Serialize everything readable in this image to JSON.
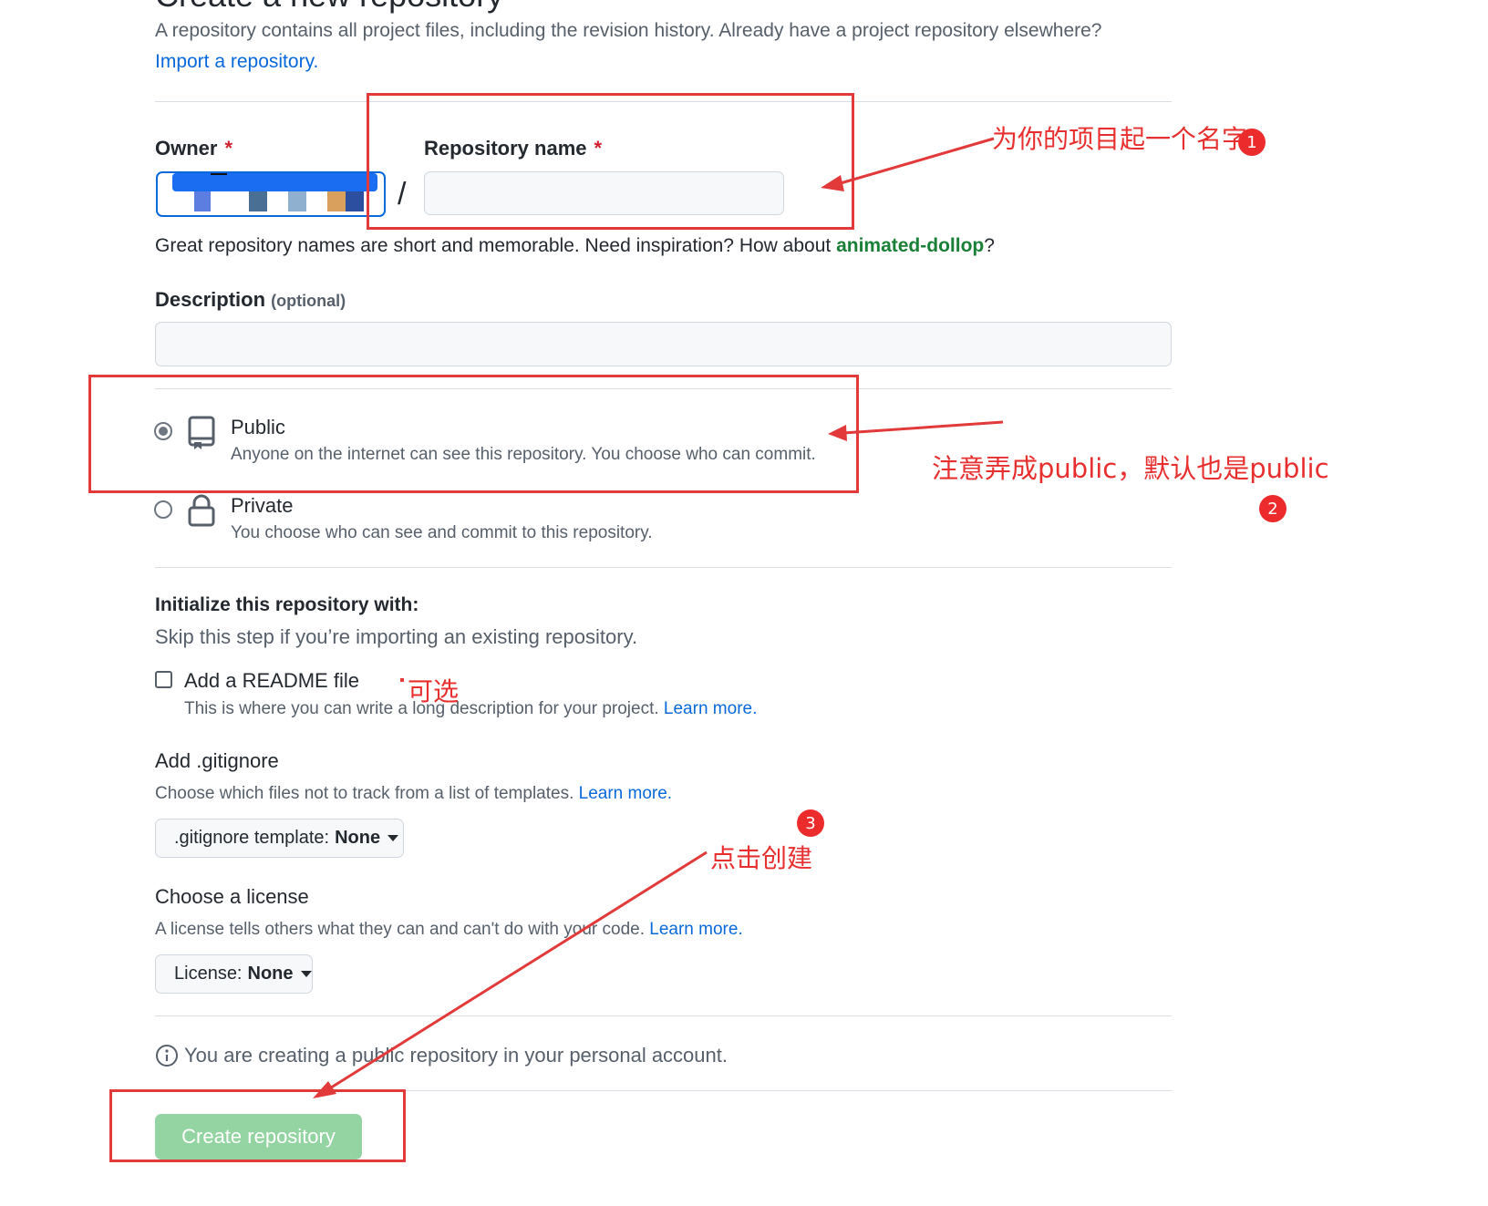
{
  "header": {
    "title_fragment": "Create a new repository",
    "intro_text": "A repository contains all project files, including the revision history. Already have a project repository elsewhere?",
    "import_link": "Import a repository."
  },
  "owner": {
    "label": "Owner",
    "required_mark": "*",
    "separator": "/"
  },
  "repo_name": {
    "label": "Repository name",
    "required_mark": "*",
    "value": ""
  },
  "name_hint": {
    "prefix": "Great repository names are short and memorable. Need inspiration? How about ",
    "suggestion": "animated-dollop",
    "suffix": "?"
  },
  "description": {
    "label": "Description",
    "optional": "(optional)",
    "value": ""
  },
  "visibility": {
    "public": {
      "title": "Public",
      "desc": "Anyone on the internet can see this repository. You choose who can commit.",
      "selected": true
    },
    "private": {
      "title": "Private",
      "desc": "You choose who can see and commit to this repository.",
      "selected": false
    }
  },
  "init": {
    "heading": "Initialize this repository with:",
    "subtext": "Skip this step if you’re importing an existing repository.",
    "readme_label": "Add a README file",
    "readme_desc": "This is where you can write a long description for your project.",
    "learn_more": "Learn more."
  },
  "gitignore": {
    "heading": "Add .gitignore",
    "desc": "Choose which files not to track from a list of templates.",
    "learn_more": "Learn more.",
    "button_prefix": ".gitignore template:",
    "button_value": "None"
  },
  "license": {
    "heading": "Choose a license",
    "desc": "A license tells others what they can and can't do with your code.",
    "learn_more": "Learn more.",
    "button_prefix": "License:",
    "button_value": "None"
  },
  "notice": "You are creating a public repository in your personal account.",
  "create_button": "Create repository",
  "annotations": {
    "a1": "为你的项目起一个名字",
    "a2": "注意弄成public，默认也是public",
    "a3": "点击创建",
    "optional": "可选",
    "n1": "1",
    "n2": "2",
    "n3": "3"
  },
  "colors": {
    "annotation_red": "#e23a3a",
    "link_blue": "#0969da",
    "suggestion_green": "#1a7f37",
    "create_green": "#94d3a2"
  }
}
